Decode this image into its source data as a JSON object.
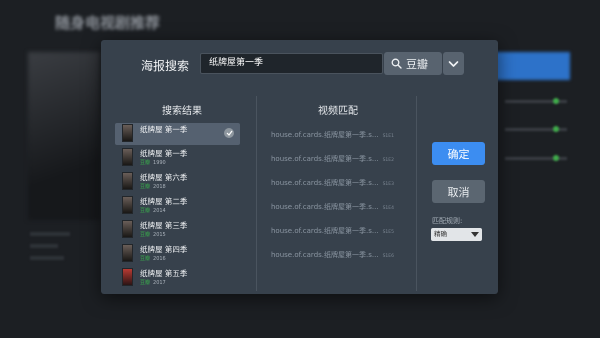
{
  "background": {
    "title": "随身电视剧推荐"
  },
  "dialog": {
    "title": "海报搜索",
    "search_value": "纸牌屋第一季",
    "source_label": "豆瓣",
    "source_icon": "search-icon",
    "dropdown_icon": "chevron-down-icon",
    "results_header": "搜索结果",
    "matches_header": "视频匹配",
    "results": [
      {
        "title": "纸牌屋 第一季",
        "meta": "",
        "year": "",
        "selected": true
      },
      {
        "title": "纸牌屋 第一季",
        "meta": "豆瓣",
        "year": "1990",
        "selected": false
      },
      {
        "title": "纸牌屋 第六季",
        "meta": "豆瓣",
        "year": "2018",
        "selected": false
      },
      {
        "title": "纸牌屋 第二季",
        "meta": "豆瓣",
        "year": "2014",
        "selected": false
      },
      {
        "title": "纸牌屋 第三季",
        "meta": "豆瓣",
        "year": "2015",
        "selected": false
      },
      {
        "title": "纸牌屋 第四季",
        "meta": "豆瓣",
        "year": "2016",
        "selected": false
      },
      {
        "title": "纸牌屋 第五季",
        "meta": "豆瓣",
        "year": "2017",
        "selected": false
      }
    ],
    "matches": [
      {
        "file": "house.of.cards.纸牌屋第一季.s...",
        "ep": "S1E1"
      },
      {
        "file": "house.of.cards.纸牌屋第一季.s...",
        "ep": "S1E2"
      },
      {
        "file": "house.of.cards.纸牌屋第一季.s...",
        "ep": "S1E3"
      },
      {
        "file": "house.of.cards.纸牌屋第一季.s...",
        "ep": "S1E4"
      },
      {
        "file": "house.of.cards.纸牌屋第一季.s...",
        "ep": "S1E5"
      },
      {
        "file": "house.of.cards.纸牌屋第一季.s...",
        "ep": "S1E6"
      }
    ],
    "ok_label": "确定",
    "cancel_label": "取消",
    "rule_label": "匹配规则:",
    "rule_value": "精确",
    "colors": {
      "primary": "#3c8df1",
      "dialog_bg": "#37414c",
      "tag_green": "#39b14c"
    }
  }
}
